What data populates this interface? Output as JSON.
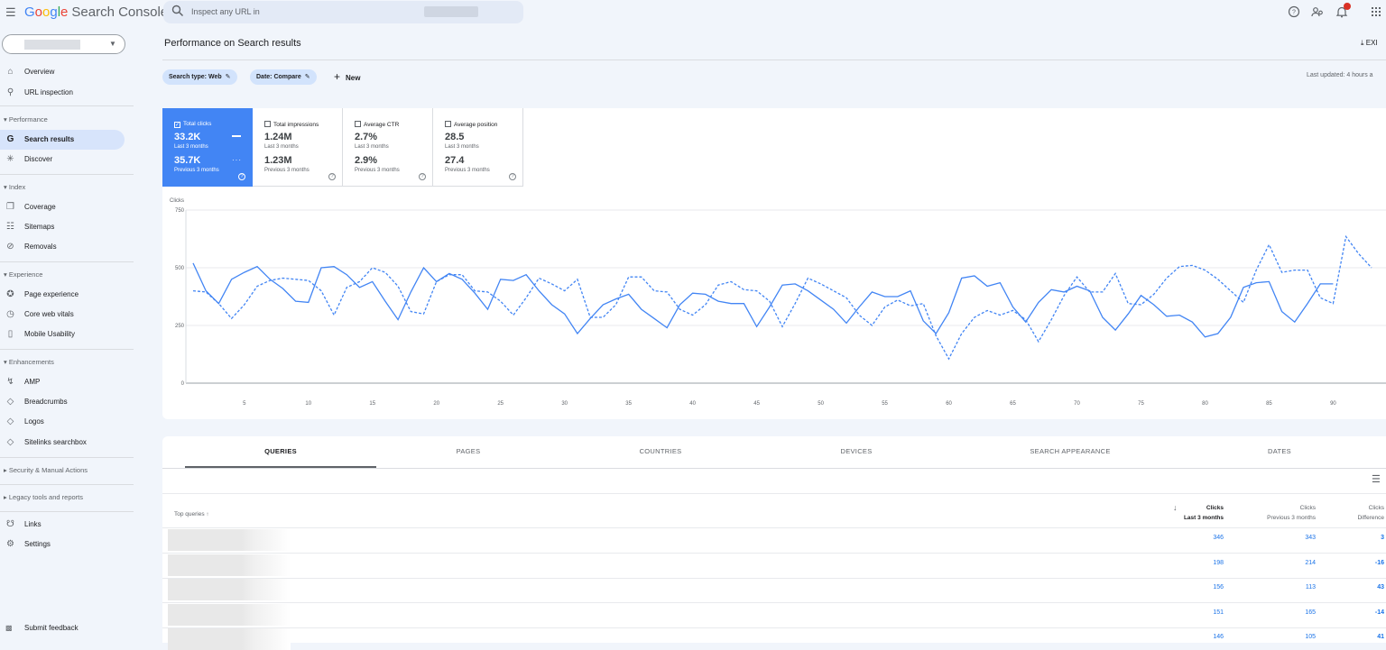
{
  "header": {
    "menu_icon": "menu-icon",
    "brand_letters": [
      "G",
      "o",
      "o",
      "g",
      "l",
      "e"
    ],
    "product": "Search Console",
    "search_placeholder": "Inspect any URL in",
    "notifications_badge": "1"
  },
  "sidebar": {
    "items": [
      {
        "label": "Overview",
        "icon": "home-icon"
      },
      {
        "label": "URL inspection",
        "icon": "search-icon"
      }
    ],
    "sections": [
      {
        "title": "Performance",
        "items": [
          {
            "label": "Search results",
            "icon": "google-g-icon",
            "active": true
          },
          {
            "label": "Discover",
            "icon": "asterisk-icon"
          }
        ]
      },
      {
        "title": "Index",
        "items": [
          {
            "label": "Coverage",
            "icon": "coverage-icon"
          },
          {
            "label": "Sitemaps",
            "icon": "sitemap-icon"
          },
          {
            "label": "Removals",
            "icon": "removals-icon"
          }
        ]
      },
      {
        "title": "Experience",
        "items": [
          {
            "label": "Page experience",
            "icon": "page-experience-icon"
          },
          {
            "label": "Core web vitals",
            "icon": "gauge-icon"
          },
          {
            "label": "Mobile Usability",
            "icon": "phone-icon"
          }
        ]
      },
      {
        "title": "Enhancements",
        "items": [
          {
            "label": "AMP",
            "icon": "lightning-icon"
          },
          {
            "label": "Breadcrumbs",
            "icon": "layers-icon"
          },
          {
            "label": "Logos",
            "icon": "layers-icon"
          },
          {
            "label": "Sitelinks searchbox",
            "icon": "layers-icon"
          }
        ]
      }
    ],
    "collapsed": [
      "Security & Manual Actions",
      "Legacy tools and reports"
    ],
    "bottom_items": [
      {
        "label": "Links",
        "icon": "links-icon"
      },
      {
        "label": "Settings",
        "icon": "gear-icon"
      }
    ],
    "feedback": "Submit feedback"
  },
  "page": {
    "title": "Performance on Search results",
    "export_label": "EXI",
    "filters": [
      "Search type: Web",
      "Date: Compare"
    ],
    "new_label": "New",
    "last_updated": "Last updated: 4 hours a"
  },
  "metrics": [
    {
      "title": "Total clicks",
      "value": "33.2K",
      "sub": "Last 3 months",
      "value2": "35.7K",
      "sub2": "Previous 3 months",
      "selected": true
    },
    {
      "title": "Total impressions",
      "value": "1.24M",
      "sub": "Last 3 months",
      "value2": "1.23M",
      "sub2": "Previous 3 months",
      "selected": false
    },
    {
      "title": "Average CTR",
      "value": "2.7%",
      "sub": "Last 3 months",
      "value2": "2.9%",
      "sub2": "Previous 3 months",
      "selected": false
    },
    {
      "title": "Average position",
      "value": "28.5",
      "sub": "Last 3 months",
      "value2": "27.4",
      "sub2": "Previous 3 months",
      "selected": false
    }
  ],
  "chart_data": {
    "type": "line",
    "ylabel": "Clicks",
    "ylim": [
      0,
      750
    ],
    "yticks": [
      0,
      250,
      500,
      750
    ],
    "xticks": [
      5,
      10,
      15,
      20,
      25,
      30,
      35,
      40,
      45,
      50,
      55,
      60,
      65,
      70,
      75,
      80,
      85,
      90
    ],
    "grid": true,
    "series": [
      {
        "style": "solid",
        "color": "#4285f4",
        "values": [
          520,
          400,
          345,
          450,
          480,
          505,
          450,
          410,
          355,
          350,
          500,
          505,
          470,
          415,
          440,
          355,
          275,
          395,
          500,
          440,
          475,
          450,
          390,
          320,
          450,
          445,
          470,
          400,
          340,
          300,
          215,
          280,
          340,
          365,
          385,
          320,
          280,
          240,
          340,
          390,
          385,
          355,
          345,
          345,
          245,
          330,
          425,
          430,
          400,
          360,
          320,
          260,
          330,
          395,
          375,
          375,
          400,
          270,
          215,
          305,
          455,
          465,
          420,
          435,
          330,
          265,
          350,
          405,
          395,
          420,
          400,
          285,
          230,
          300,
          380,
          340,
          290,
          295,
          265,
          200,
          215,
          285,
          415,
          435,
          440,
          310,
          265,
          345,
          430,
          430
        ]
      },
      {
        "style": "dashed",
        "color": "#4285f4",
        "values": [
          400,
          395,
          345,
          280,
          340,
          420,
          445,
          455,
          450,
          445,
          400,
          295,
          415,
          440,
          500,
          480,
          420,
          310,
          300,
          440,
          470,
          470,
          400,
          395,
          355,
          295,
          370,
          455,
          430,
          400,
          450,
          285,
          285,
          340,
          460,
          460,
          400,
          395,
          320,
          295,
          340,
          425,
          440,
          405,
          400,
          355,
          245,
          345,
          455,
          430,
          400,
          370,
          295,
          250,
          330,
          360,
          335,
          345,
          205,
          105,
          215,
          285,
          315,
          295,
          315,
          275,
          180,
          275,
          380,
          460,
          395,
          395,
          475,
          345,
          340,
          385,
          455,
          505,
          510,
          490,
          450,
          400,
          350,
          490,
          600,
          480,
          490,
          490,
          370,
          345
        ]
      },
      {
        "style": "solid-tail",
        "color": "#4285f4",
        "values": [
          635,
          560,
          500
        ]
      }
    ]
  },
  "table": {
    "tabs": [
      "QUERIES",
      "PAGES",
      "COUNTRIES",
      "DEVICES",
      "SEARCH APPEARANCE",
      "DATES"
    ],
    "query_header": "Top queries",
    "col1": {
      "line1": "Clicks",
      "line2": "Last 3 months"
    },
    "col2": {
      "line1": "Clicks",
      "line2": "Previous 3 months"
    },
    "col3": {
      "line1": "Clicks",
      "line2": "Difference"
    },
    "rows": [
      {
        "last": "346",
        "prev": "343",
        "diff": "3"
      },
      {
        "last": "198",
        "prev": "214",
        "diff": "-16"
      },
      {
        "last": "156",
        "prev": "113",
        "diff": "43"
      },
      {
        "last": "151",
        "prev": "165",
        "diff": "-14"
      },
      {
        "last": "146",
        "prev": "105",
        "diff": "41"
      }
    ]
  },
  "colors": {
    "accent": "#4285f4",
    "active_nav": "#d7e4fb",
    "link": "#1a73e8"
  }
}
